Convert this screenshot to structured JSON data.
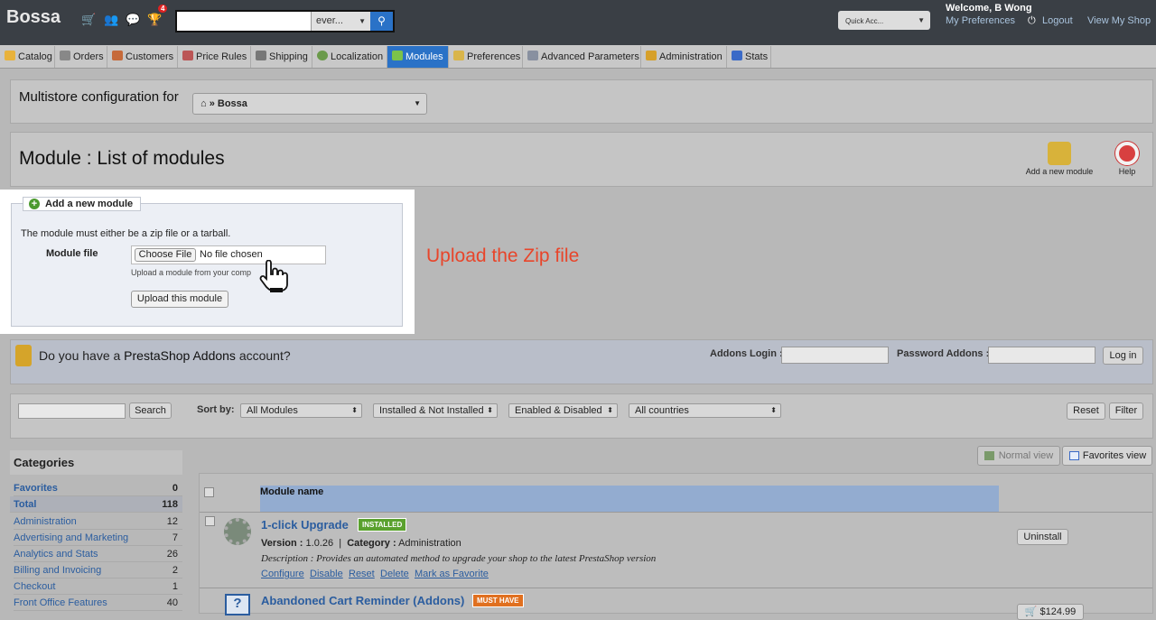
{
  "app": {
    "title": "Bossa",
    "cart_badge": "4"
  },
  "header": {
    "search": {
      "value": "",
      "scope": "ever..."
    },
    "quick_access": "Quick Acc...",
    "welcome": "Welcome, B Wong",
    "my_preferences": "My Preferences",
    "logout": "Logout",
    "view_shop": "View My Shop"
  },
  "tabs": [
    {
      "label": "Catalog",
      "icon": "folder-icon"
    },
    {
      "label": "Orders",
      "icon": "cart-icon"
    },
    {
      "label": "Customers",
      "icon": "user-icon"
    },
    {
      "label": "Price Rules",
      "icon": "price-tag-icon"
    },
    {
      "label": "Shipping",
      "icon": "truck-icon"
    },
    {
      "label": "Localization",
      "icon": "globe-icon"
    },
    {
      "label": "Modules",
      "icon": "puzzle-icon"
    },
    {
      "label": "Preferences",
      "icon": "preferences-icon"
    },
    {
      "label": "Advanced Parameters",
      "icon": "wrench-icon"
    },
    {
      "label": "Administration",
      "icon": "key-icon"
    },
    {
      "label": "Stats",
      "icon": "bar-chart-icon"
    }
  ],
  "multistore": {
    "label": "Multistore configuration for",
    "selected": "» Bossa"
  },
  "page": {
    "title": "Module : List of modules",
    "add_new_module": "Add a new module",
    "help": "Help"
  },
  "upload": {
    "legend": "Add a new module",
    "notice": "The module must either be a zip file or a tarball.",
    "field_label": "Module file",
    "choose_button": "Choose File",
    "no_file": "No file chosen",
    "hint": "Upload a module from your comp",
    "submit": "Upload this module"
  },
  "annotation": "Upload the Zip file",
  "addons": {
    "question_pre": "Do you have a ",
    "question_brand": "PrestaShop Addons",
    "question_post": " account?",
    "login_label": "Addons Login :",
    "password_label": "Password Addons :",
    "login_button": "Log in"
  },
  "filters": {
    "search_button": "Search",
    "sort_label": "Sort by:",
    "sort_value": "All Modules",
    "install_value": "Installed & Not Installed",
    "enabled_value": "Enabled & Disabled",
    "country_value": "All countries",
    "reset": "Reset",
    "filter": "Filter"
  },
  "views": {
    "normal": "Normal view",
    "favorites": "Favorites view"
  },
  "categories": {
    "title": "Categories",
    "items": [
      {
        "name": "Favorites",
        "count": "0"
      },
      {
        "name": "Total",
        "count": "118"
      },
      {
        "name": "Administration",
        "count": "12"
      },
      {
        "name": "Advertising and Marketing",
        "count": "7"
      },
      {
        "name": "Analytics and Stats",
        "count": "26"
      },
      {
        "name": "Billing and Invoicing",
        "count": "2"
      },
      {
        "name": "Checkout",
        "count": "1"
      },
      {
        "name": "Front Office Features",
        "count": "40"
      }
    ]
  },
  "table": {
    "column": "Module name"
  },
  "modules": [
    {
      "name": "1-click Upgrade",
      "status": "INSTALLED",
      "version_label": "Version :",
      "version": "1.0.26",
      "category_label": "Category :",
      "category": "Administration",
      "description_label": "Description :",
      "description": "Provides an automated method to upgrade your shop to the latest PrestaShop version",
      "actions": [
        "Configure",
        "Disable",
        "Reset",
        "Delete",
        "Mark as Favorite"
      ],
      "button": "Uninstall"
    },
    {
      "name": "Abandoned Cart Reminder (Addons)",
      "status": "MUST HAVE",
      "price": "$124.99"
    }
  ],
  "colors": {
    "accent": "#2a72c7",
    "installed": "#5aa12e",
    "must_have": "#e07020",
    "annotation": "#e8452a"
  }
}
